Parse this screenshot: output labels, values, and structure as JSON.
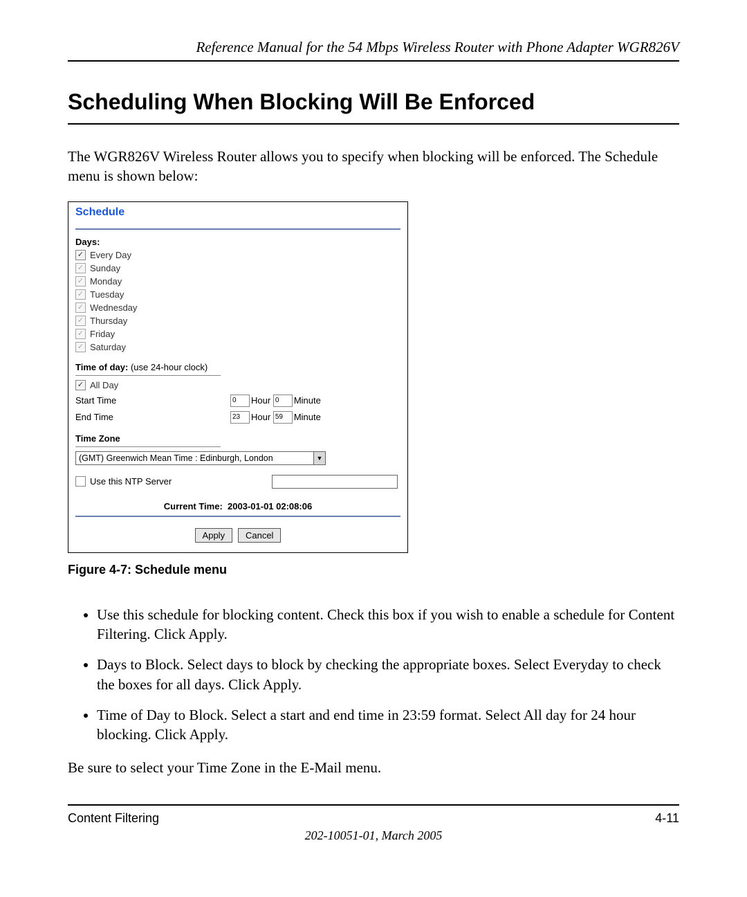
{
  "header": {
    "manual_title": "Reference Manual for the 54 Mbps Wireless Router with Phone Adapter WGR826V"
  },
  "section": {
    "heading": "Scheduling When Blocking Will Be Enforced",
    "intro": "The WGR826V Wireless Router allows you to specify when blocking will be enforced. The Schedule menu is shown below:"
  },
  "screenshot": {
    "title": "Schedule",
    "days_label": "Days:",
    "days": [
      {
        "label": "Every Day",
        "checked": true,
        "enabled": true
      },
      {
        "label": "Sunday",
        "checked": true,
        "enabled": false
      },
      {
        "label": "Monday",
        "checked": true,
        "enabled": false
      },
      {
        "label": "Tuesday",
        "checked": true,
        "enabled": false
      },
      {
        "label": "Wednesday",
        "checked": true,
        "enabled": false
      },
      {
        "label": "Thursday",
        "checked": true,
        "enabled": false
      },
      {
        "label": "Friday",
        "checked": true,
        "enabled": false
      },
      {
        "label": "Saturday",
        "checked": true,
        "enabled": false
      }
    ],
    "tod_label": "Time of day:",
    "tod_note": " (use 24-hour clock)",
    "all_day": {
      "label": "All Day",
      "checked": true
    },
    "start": {
      "label": "Start Time",
      "hour": "0",
      "minute": "0"
    },
    "end": {
      "label": "End Time",
      "hour": "23",
      "minute": "59"
    },
    "hour_label": "Hour",
    "minute_label": "Minute",
    "tz_label": "Time Zone",
    "tz_value": "(GMT) Greenwich Mean Time : Edinburgh, London",
    "ntp_label": "Use this NTP Server",
    "ntp_checked": false,
    "current_time_label": "Current Time:",
    "current_time_value": "2003-01-01 02:08:06",
    "apply": "Apply",
    "cancel": "Cancel"
  },
  "figure_caption": "Figure 4-7:  Schedule menu",
  "bullets": [
    "Use this schedule for blocking content. Check this box if you wish to enable a schedule for Content Filtering. Click Apply.",
    "Days to Block. Select days to block by checking the appropriate boxes. Select Everyday to check the boxes for all days. Click Apply.",
    "Time of Day to Block. Select a start and end time in 23:59 format. Select All day for 24 hour blocking. Click Apply."
  ],
  "closing": "Be sure to select your Time Zone in the E-Mail menu.",
  "footer": {
    "section_name": "Content Filtering",
    "page_number": "4-11",
    "doc_id": "202-10051-01, March 2005"
  }
}
